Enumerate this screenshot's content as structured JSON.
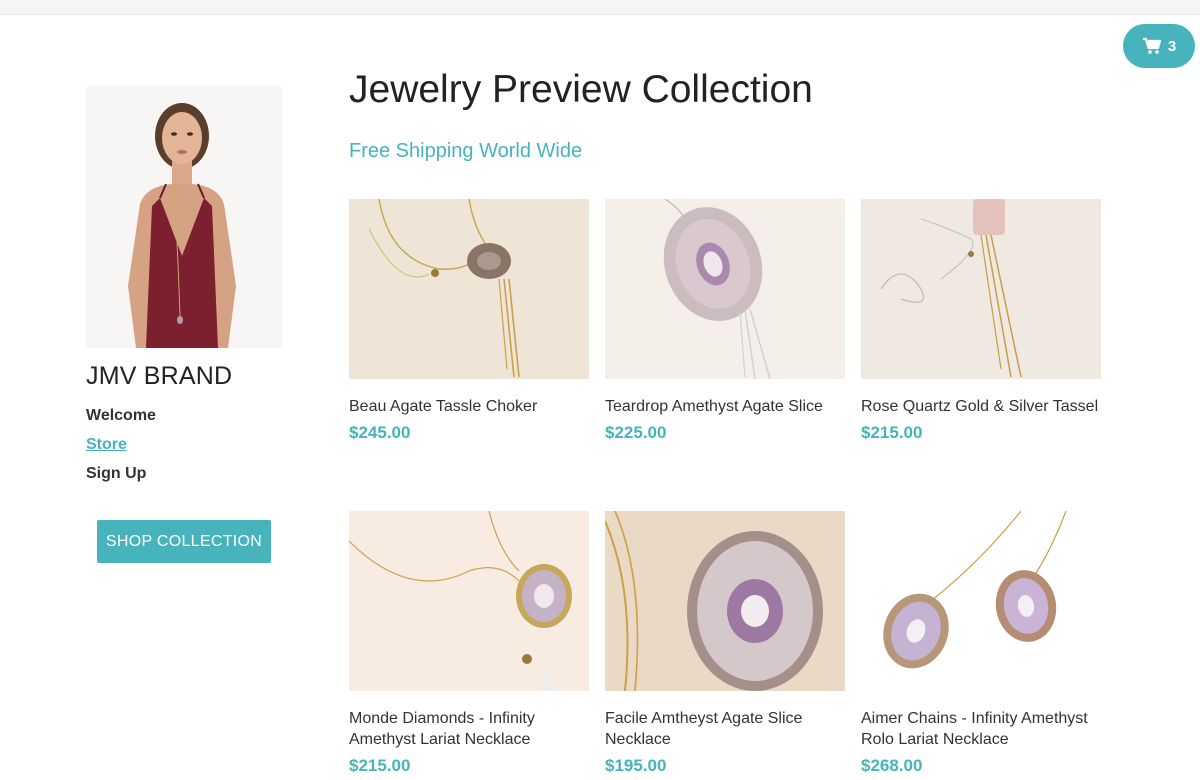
{
  "cart": {
    "count": "3",
    "icon": "shopping-cart-icon"
  },
  "sidebar": {
    "brand": "JMV BRAND",
    "nav": [
      {
        "label": "Welcome"
      },
      {
        "label": "Store"
      },
      {
        "label": "Sign Up"
      }
    ],
    "shop_button": "SHOP COLLECTION"
  },
  "main": {
    "title": "Jewelry Preview Collection",
    "subtitle": "Free Shipping World Wide"
  },
  "products": [
    {
      "name": "Beau Agate Tassle Choker",
      "price": "$245.00"
    },
    {
      "name": "Teardrop Amethyst Agate Slice",
      "price": "$225.00"
    },
    {
      "name": "Rose Quartz Gold & Silver Tassel",
      "price": "$215.00"
    },
    {
      "name": "Monde Diamonds - Infinity Amethyst Lariat Necklace",
      "price": "$215.00"
    },
    {
      "name": "Facile Amtheyst Agate Slice Necklace",
      "price": "$195.00"
    },
    {
      "name": "Aimer Chains - Infinity Amethyst Rolo Lariat Necklace",
      "price": "$268.00"
    }
  ],
  "colors": {
    "accent": "#46b3bd",
    "text": "#222222"
  }
}
